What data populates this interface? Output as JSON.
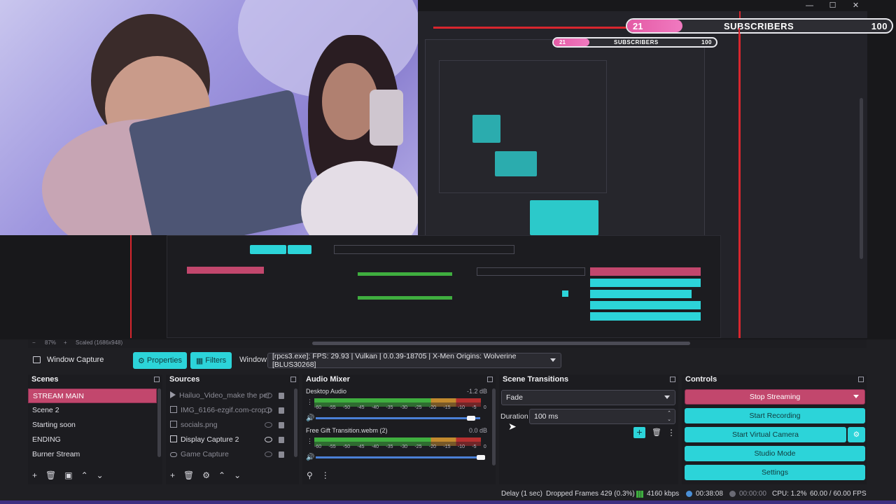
{
  "window": {
    "minimize": "—",
    "maximize": "☐",
    "close": "✕"
  },
  "overlay": {
    "count": "21",
    "label": "SUBSCRIBERS",
    "goal": "100",
    "progress": 0.21
  },
  "zoom": {
    "minus": "−",
    "value": "87%",
    "plus": "+",
    "scaled": "Scaled (1686x948)"
  },
  "source_toolbar": {
    "source_name": "Window Capture",
    "properties_label": "Properties",
    "filters_label": "Filters",
    "window_label": "Window",
    "window_value": "[rpcs3.exe]: FPS: 29.93 | Vulkan | 0.0.39-18705 | X-Men Origins: Wolverine [BLUS30268]"
  },
  "scenes": {
    "title": "Scenes",
    "items": [
      {
        "label": "STREAM MAIN",
        "selected": true
      },
      {
        "label": "Scene 2"
      },
      {
        "label": "Starting soon"
      },
      {
        "label": "ENDING"
      },
      {
        "label": "Burner Stream"
      }
    ]
  },
  "sources": {
    "title": "Sources",
    "items": [
      {
        "label": "Hailuo_Video_make the per",
        "icon": "play-icon",
        "visible": false
      },
      {
        "label": "IMG_6166-ezgif.com-crop.p",
        "icon": "image-icon",
        "visible": false
      },
      {
        "label": "socials.png",
        "icon": "image-icon",
        "visible": false
      },
      {
        "label": "Display Capture 2",
        "icon": "display-icon",
        "visible": true
      },
      {
        "label": "Game Capture",
        "icon": "gamepad-icon",
        "visible": false
      }
    ]
  },
  "audio_mixer": {
    "title": "Audio Mixer",
    "tick_labels": [
      "-60",
      "-55",
      "-50",
      "-45",
      "-40",
      "-35",
      "-30",
      "-25",
      "-20",
      "-15",
      "-10",
      "-5",
      "0"
    ],
    "channels": [
      {
        "name": "Desktop Audio",
        "db": "-1.2 dB",
        "volume": 0.95
      },
      {
        "name": "Free Gift Transition.webm (2)",
        "db": "0.0 dB",
        "volume": 1.0
      }
    ]
  },
  "scene_transitions": {
    "title": "Scene Transitions",
    "transition": "Fade",
    "duration_label": "Duration",
    "duration_value": "100 ms"
  },
  "controls": {
    "title": "Controls",
    "stop_streaming": "Stop Streaming",
    "start_recording": "Start Recording",
    "start_virtual_camera": "Start Virtual Camera",
    "studio_mode": "Studio Mode",
    "settings": "Settings"
  },
  "status": {
    "delay": "Delay (1 sec)",
    "dropped": "Dropped Frames 429 (0.3%)",
    "bitrate": "4160 kbps",
    "stream_time": "00:38:08",
    "rec_time": "00:00:00",
    "cpu": "CPU: 1.2%",
    "fps": "60.00 / 60.00 FPS"
  },
  "colors": {
    "accent_cyan": "#2cd4d9",
    "accent_pink": "#c2476d",
    "meter_green": "#3fae3f"
  }
}
